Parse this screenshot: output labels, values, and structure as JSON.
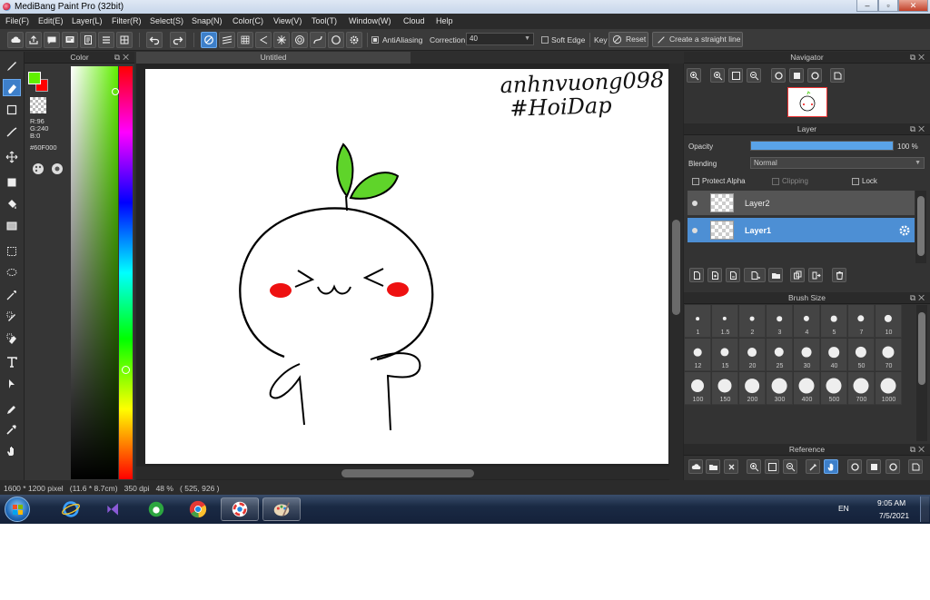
{
  "window": {
    "title": "MediBang Paint Pro (32bit)",
    "minimize": "–",
    "restore": "▫",
    "close": "✕"
  },
  "menu": [
    "File(F)",
    "Edit(E)",
    "Layer(L)",
    "Filter(R)",
    "Select(S)",
    "Snap(N)",
    "Color(C)",
    "View(V)",
    "Tool(T)",
    "Window(W)",
    "Cloud",
    "Help"
  ],
  "toolbar": {
    "antialiasing": "AntiAliasing",
    "correction_label": "Correction",
    "correction_value": "40",
    "soft_edge": "Soft Edge",
    "key": "Key",
    "reset": "Reset",
    "straight_line": "Create a straight line"
  },
  "color_panel": {
    "title": "Color",
    "r": "R:96",
    "g": "G:240",
    "b": "B:0",
    "hex": "#60F000",
    "primary_color": "#60f000",
    "secondary_color": "#ff0000"
  },
  "canvas": {
    "tab_title": "Untitled",
    "watermark_line1": "anhnvuong098",
    "watermark_line2": "#HoiDap"
  },
  "navigator": {
    "title": "Navigator"
  },
  "layer_panel": {
    "title": "Layer",
    "opacity_label": "Opacity",
    "opacity_value": "100 %",
    "opacity_fraction": 1.0,
    "blending_label": "Blending",
    "blending_value": "Normal",
    "protect_alpha": "Protect Alpha",
    "clipping": "Clipping",
    "lock": "Lock",
    "layers": [
      {
        "name": "Layer2",
        "selected": false
      },
      {
        "name": "Layer1",
        "selected": true
      }
    ]
  },
  "brush_size": {
    "title": "Brush Size",
    "sizes": [
      "1",
      "1.5",
      "2",
      "3",
      "4",
      "5",
      "7",
      "10",
      "12",
      "15",
      "20",
      "25",
      "30",
      "40",
      "50",
      "70",
      "100",
      "150",
      "200",
      "300",
      "400",
      "500",
      "700",
      "1000"
    ]
  },
  "reference": {
    "title": "Reference"
  },
  "status": {
    "text": "1600 * 1200 pixel   (11.6 * 8.7cm)   350 dpi   48 %   ( 525, 926 )"
  },
  "taskbar": {
    "lang": "EN",
    "time": "9:05 AM",
    "date": "7/5/2021"
  },
  "colors": {
    "accent": "#3d7fc9",
    "leaf_green": "#5fd42a",
    "cheek_red": "#ee1111"
  }
}
